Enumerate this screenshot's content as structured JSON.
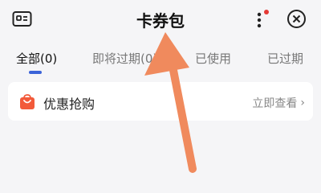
{
  "header": {
    "title": "卡券包"
  },
  "tabs": [
    {
      "label": "全部(0)",
      "active": true
    },
    {
      "label": "即将过期(0)",
      "active": false
    },
    {
      "label": "已使用",
      "active": false
    },
    {
      "label": "已过期",
      "active": false
    }
  ],
  "coupon_entry": {
    "label": "优惠抢购",
    "action": "立即查看",
    "chevron": "›"
  },
  "colors": {
    "accent": "#3b63d8",
    "arrow": "#f08a5d",
    "badge": "#e53935",
    "bag": "#f25a3a"
  },
  "icons": [
    "card-icon",
    "more-vertical-icon",
    "close-circle-icon",
    "shopping-bag-icon",
    "chevron-right-icon",
    "annotation-arrow"
  ]
}
